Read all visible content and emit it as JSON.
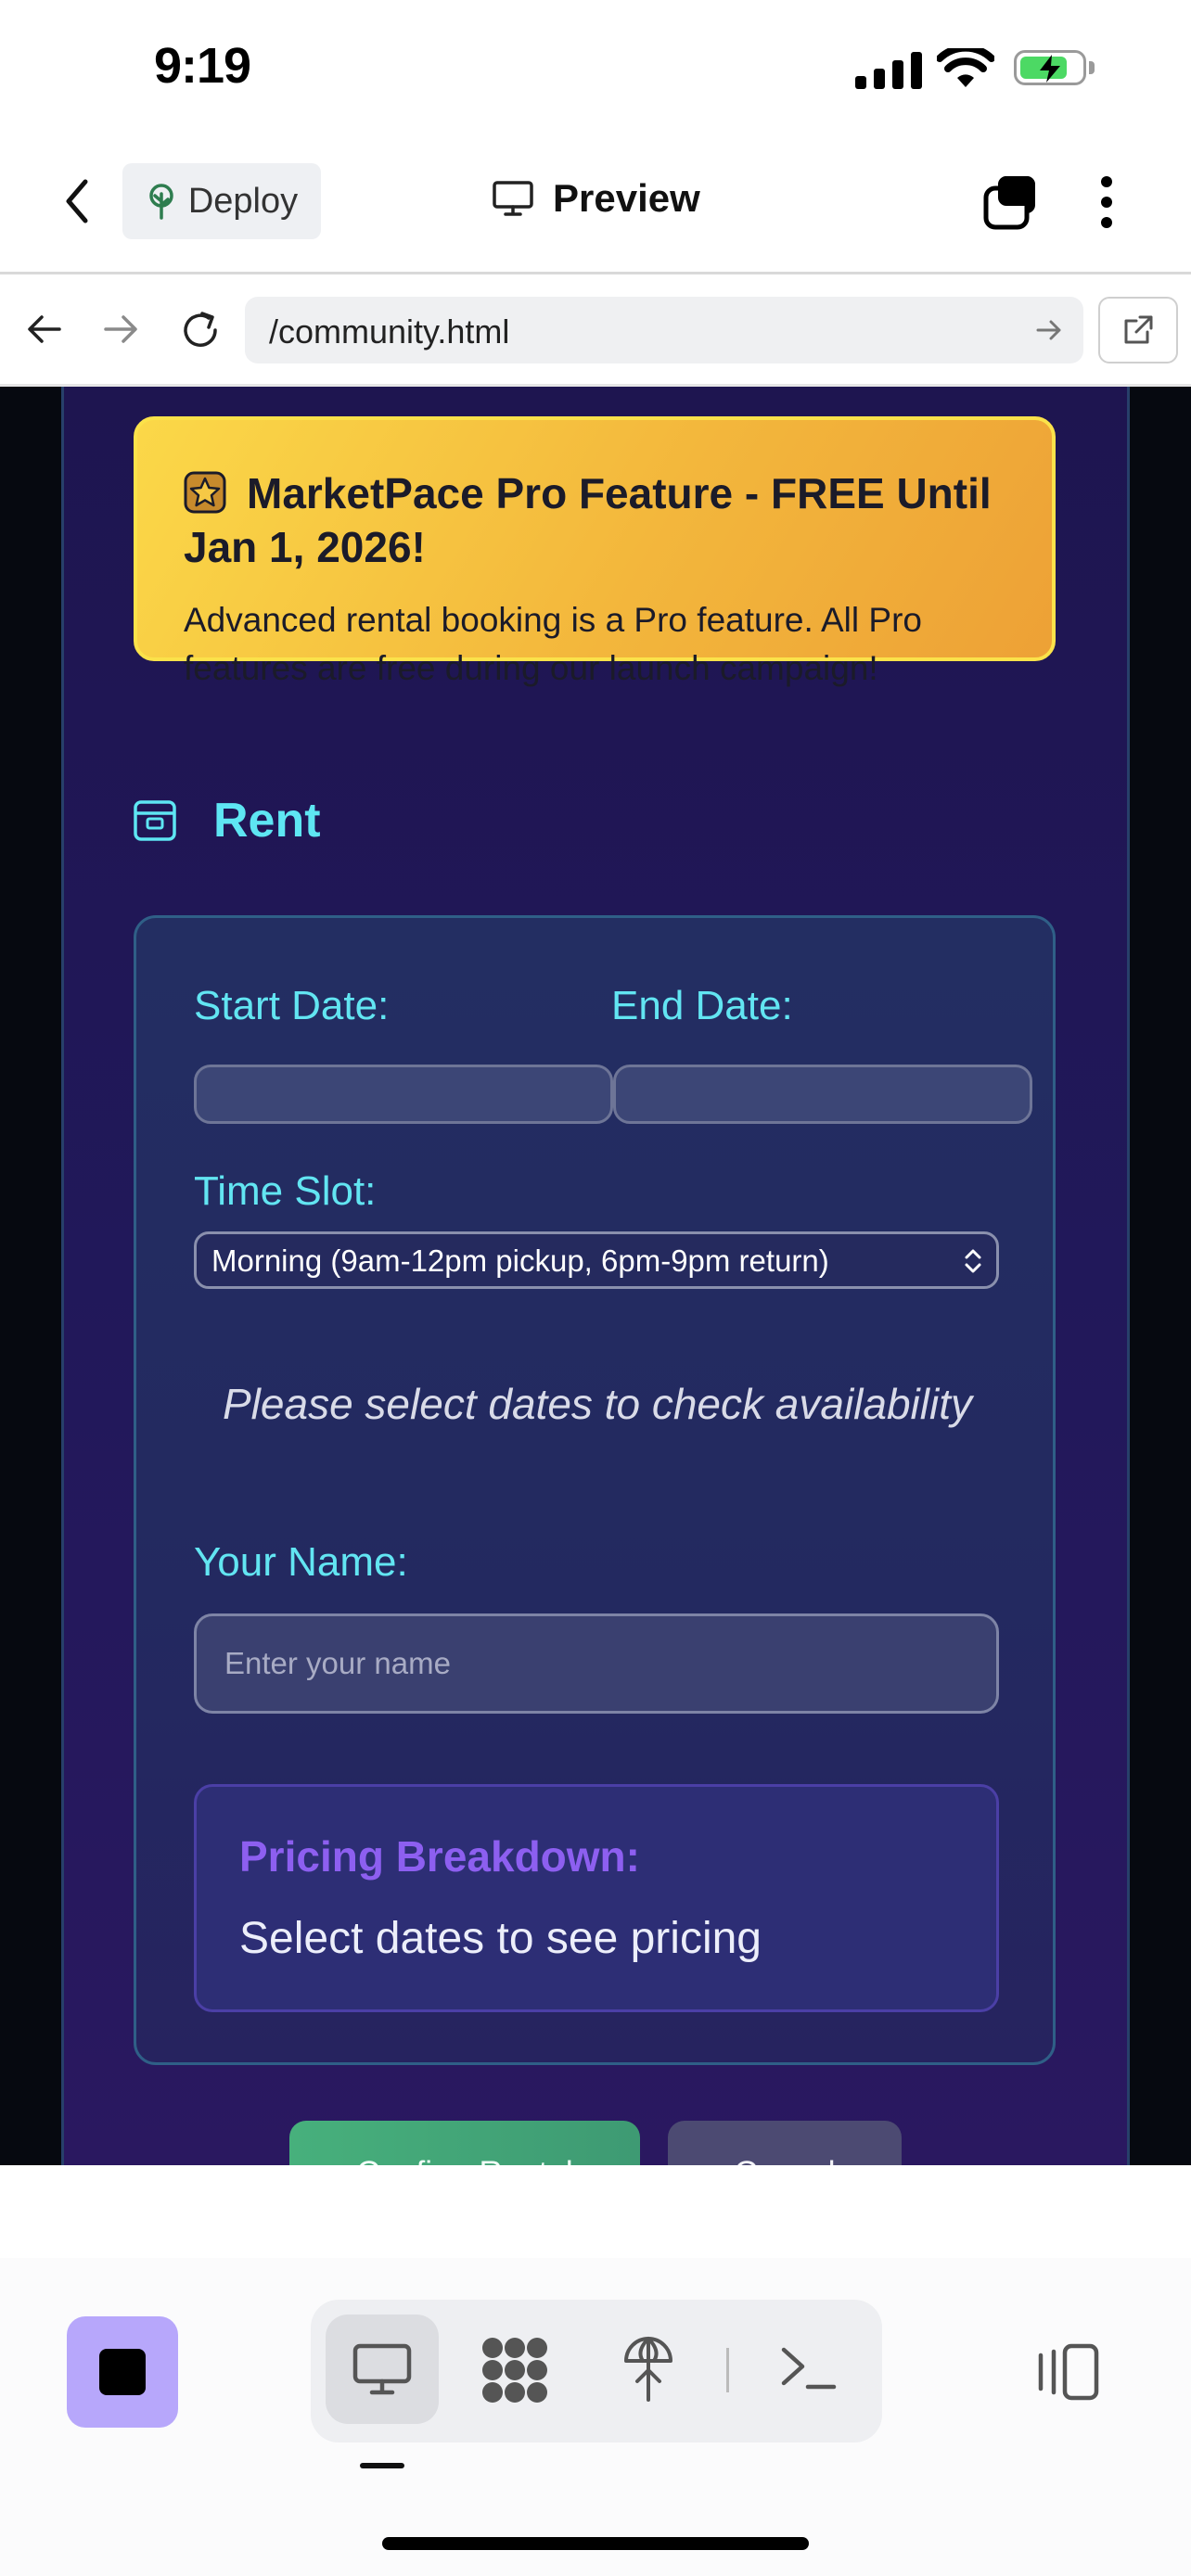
{
  "status_bar": {
    "time": "9:19"
  },
  "header": {
    "deploy_label": "Deploy",
    "preview_label": "Preview"
  },
  "browser": {
    "url": "/community.html"
  },
  "promo": {
    "title": "MarketPace Pro Feature - FREE Until Jan 1, 2026!",
    "body": "Advanced rental booking is a Pro feature. All Pro features are free during our launch campaign!"
  },
  "rent": {
    "title": "Rent"
  },
  "form": {
    "start_date_label": "Start Date:",
    "end_date_label": "End Date:",
    "time_slot_label": "Time Slot:",
    "time_slot_value": "Morning (9am-12pm pickup, 6pm-9pm return)",
    "availability_note": "Please select dates to check availability",
    "name_label": "Your Name:",
    "name_placeholder": "Enter your name",
    "pricing_title": "Pricing Breakdown:",
    "pricing_text": "Select dates to see pricing"
  },
  "actions": {
    "confirm_label": "Confirm Rental",
    "cancel_label": "Cancel"
  },
  "colors": {
    "accent_cyan": "#5ee6f3",
    "promo_yellow": "#fbd848",
    "confirm_green": "#47b07c",
    "pricing_purple": "#8d5ff0",
    "stop_button": "#b7a7fb"
  },
  "icons": {
    "deploy": "tree-icon",
    "preview": "monitor-icon",
    "promo": "star-icon",
    "rent": "calendar-box-icon",
    "toolbar": [
      "monitor-icon",
      "grid-blob-icon",
      "antenna-icon",
      "terminal-icon",
      "panel-toggle-icon"
    ]
  }
}
